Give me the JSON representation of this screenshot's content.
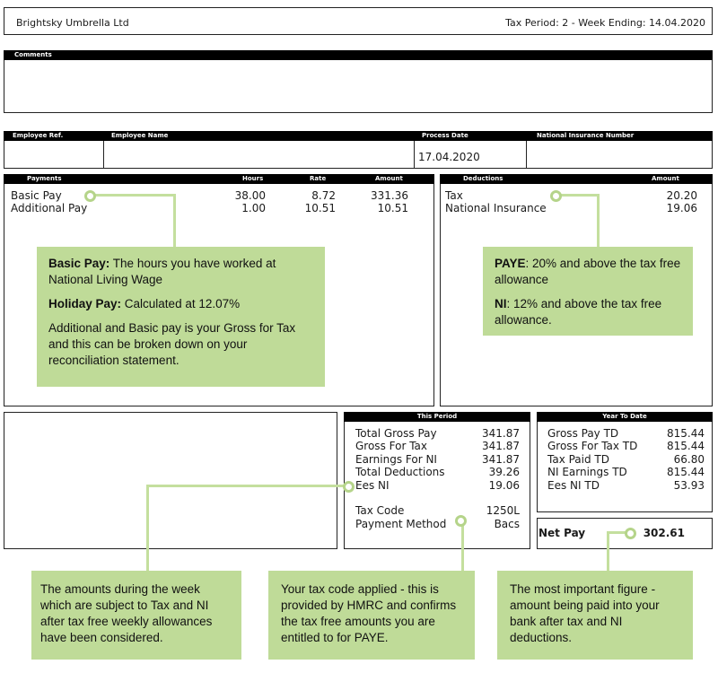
{
  "header": {
    "company": "Brightsky Umbrella Ltd",
    "period": "Tax Period: 2 - Week Ending: 14.04.2020"
  },
  "comments": {
    "label": "Comments"
  },
  "employee": {
    "ref_label": "Employee Ref.",
    "name_label": "Employee Name",
    "process_date_label": "Process Date",
    "process_date": "17.04.2020",
    "ni_number_label": "National Insurance Number"
  },
  "payments": {
    "headers": {
      "title": "Payments",
      "hours": "Hours",
      "rate": "Rate",
      "amount": "Amount"
    },
    "rows": [
      {
        "label": "Basic Pay",
        "hours": "38.00",
        "rate": "8.72",
        "amount": "331.36"
      },
      {
        "label": "Additional Pay",
        "hours": "1.00",
        "rate": "10.51",
        "amount": "10.51"
      }
    ]
  },
  "deductions": {
    "headers": {
      "title": "Deductions",
      "amount": "Amount"
    },
    "rows": [
      {
        "label": "Tax",
        "amount": "20.20"
      },
      {
        "label": "National Insurance",
        "amount": "19.06"
      }
    ]
  },
  "this_period": {
    "title": "This Period",
    "rows": [
      {
        "label": "Total Gross Pay",
        "value": "341.87"
      },
      {
        "label": "Gross For Tax",
        "value": "341.87"
      },
      {
        "label": "Earnings For NI",
        "value": "341.87"
      },
      {
        "label": "Total Deductions",
        "value": "39.26"
      },
      {
        "label": "Ees NI",
        "value": "19.06"
      }
    ],
    "tax_code_label": "Tax Code",
    "tax_code": "1250L",
    "payment_method_label": "Payment Method",
    "payment_method": "Bacs"
  },
  "year_to_date": {
    "title": "Year To Date",
    "rows": [
      {
        "label": "Gross Pay TD",
        "value": "815.44"
      },
      {
        "label": "Gross For Tax TD",
        "value": "815.44"
      },
      {
        "label": "Tax Paid TD",
        "value": "66.80"
      },
      {
        "label": "NI Earnings TD",
        "value": "815.44"
      },
      {
        "label": "Ees NI TD",
        "value": "53.93"
      }
    ]
  },
  "net_pay": {
    "label": "Net Pay",
    "value": "302.61"
  },
  "callouts": {
    "basic_pay": {
      "b1": "Basic Pay:",
      "t1": " The hours you have worked at National Living Wage",
      "b2": "Holiday Pay:",
      "t2": " Calculated at 12.07%",
      "t3": "Additional and Basic pay is your Gross for Tax and this can be broken down on your reconciliation statement."
    },
    "paye": {
      "b1": "PAYE",
      "t1": ": 20% and above the tax free allowance",
      "b2": "NI",
      "t2": ": 12% and above the tax free allowance."
    },
    "amounts": {
      "text": "The amounts during the week which are subject to Tax and NI after tax free weekly allowances have been considered."
    },
    "tax_code": {
      "text": "Your tax code applied - this is provided by HMRC and confirms the tax free amounts you are entitled to for PAYE."
    },
    "net_pay": {
      "text": "The most important figure - amount being paid into your bank after tax and NI deductions."
    }
  },
  "colors": {
    "callout": "#bfdb98",
    "header_bar": "#000000"
  }
}
